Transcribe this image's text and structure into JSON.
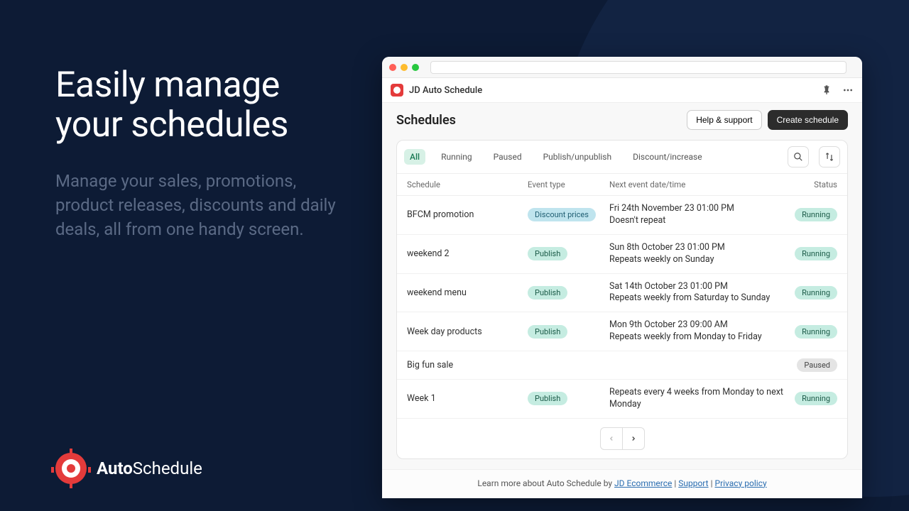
{
  "marketing": {
    "headline_l1": "Easily manage",
    "headline_l2": "your schedules",
    "subhead": "Manage your sales, promotions, product releases, discounts and daily deals, all from one handy screen.",
    "brand_prefix": "Auto",
    "brand_suffix": "Schedule"
  },
  "app_header": {
    "title": "JD Auto Schedule"
  },
  "page": {
    "title": "Schedules",
    "help_btn": "Help & support",
    "create_btn": "Create schedule"
  },
  "tabs": {
    "all": "All",
    "running": "Running",
    "paused": "Paused",
    "pubunpub": "Publish/unpublish",
    "discinc": "Discount/increase"
  },
  "columns": {
    "schedule": "Schedule",
    "event_type": "Event type",
    "next_event": "Next event date/time",
    "status": "Status"
  },
  "event_labels": {
    "discount_prices": "Discount prices",
    "publish": "Publish"
  },
  "status_labels": {
    "running": "Running",
    "paused": "Paused"
  },
  "rows": [
    {
      "name": "BFCM promotion",
      "event_type": "discount_prices",
      "next_l1": "Fri 24th November 23 01:00 PM",
      "next_l2": "Doesn't repeat",
      "status": "running"
    },
    {
      "name": "weekend 2",
      "event_type": "publish",
      "next_l1": "Sun 8th October 23 01:00 PM",
      "next_l2": "Repeats weekly on Sunday",
      "status": "running"
    },
    {
      "name": "weekend menu",
      "event_type": "publish",
      "next_l1": "Sat 14th October 23 01:00 PM",
      "next_l2": "Repeats weekly from Saturday to Sunday",
      "status": "running"
    },
    {
      "name": "Week day products",
      "event_type": "publish",
      "next_l1": "Mon 9th October 23 09:00 AM",
      "next_l2": "Repeats weekly from Monday to Friday",
      "status": "running"
    },
    {
      "name": "Big fun sale",
      "event_type": "",
      "next_l1": "",
      "next_l2": "",
      "status": "paused"
    },
    {
      "name": "Week 1",
      "event_type": "publish",
      "next_l1": "",
      "next_l2": "Repeats every 4 weeks from Monday to next Monday",
      "status": "running"
    }
  ],
  "footer": {
    "prefix": "Learn more about Auto Schedule by ",
    "link1": "JD Ecommerce",
    "sep": " | ",
    "link2": "Support",
    "link3": "Privacy policy"
  }
}
